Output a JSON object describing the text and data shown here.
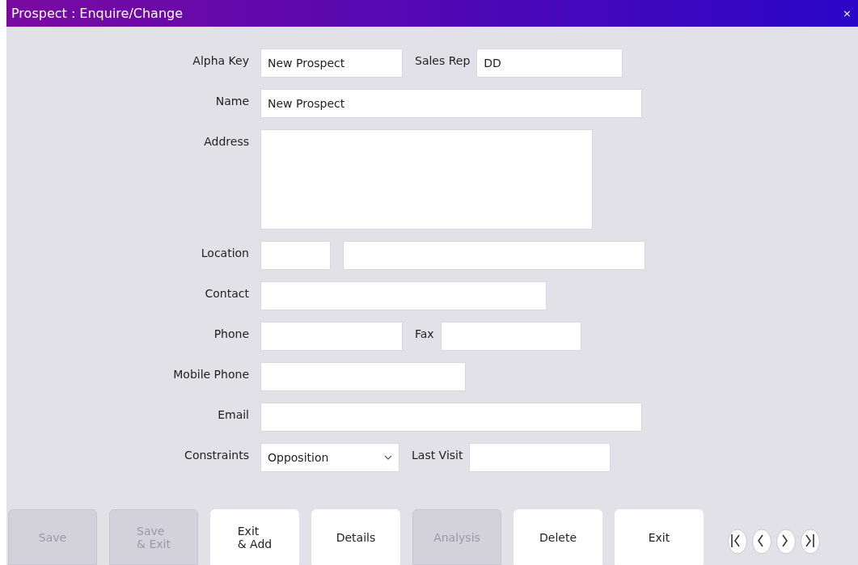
{
  "window": {
    "title": "Prospect : Enquire/Change",
    "close": "×"
  },
  "rows": [
    {
      "fields": [
        {
          "label": "Alpha Key",
          "value": "New Prospect"
        },
        {
          "label": "Sales Rep",
          "value": "DD"
        }
      ]
    },
    {
      "fields": [
        {
          "label": "Name",
          "value": "New Prospect"
        }
      ]
    },
    {
      "fields": [
        {
          "label": "Address",
          "kind": "textarea"
        }
      ]
    },
    {
      "fields": [
        {
          "label": "Location"
        },
        {
          "kind": "textbox"
        }
      ]
    },
    {
      "fields": [
        {
          "label": "Contact"
        }
      ]
    },
    {
      "fields": [
        {
          "label": "Phone"
        },
        {
          "label": "Fax"
        }
      ]
    },
    {
      "fields": [
        {
          "label": "Mobile Phone"
        }
      ]
    },
    {
      "fields": [
        {
          "label": "Email"
        }
      ]
    },
    {
      "fields": [
        {
          "label": "Constraints",
          "value": "Opposition",
          "kind": "dropdown"
        },
        {
          "label": "Last Visit"
        }
      ]
    }
  ],
  "buttons": [
    {
      "label": "Save",
      "disabled": true
    },
    {
      "label": "Save\n& Exit",
      "disabled": true
    },
    {
      "label": "Exit\n& Add",
      "disabled": false
    },
    {
      "label": "Details",
      "disabled": false
    },
    {
      "label": "Analysis",
      "disabled": true
    },
    {
      "label": "Delete",
      "disabled": false
    },
    {
      "label": "Exit",
      "disabled": false
    }
  ],
  "nav": [
    {
      "kind": "first"
    },
    {
      "kind": "prev"
    },
    {
      "kind": "next"
    },
    {
      "kind": "last"
    }
  ]
}
